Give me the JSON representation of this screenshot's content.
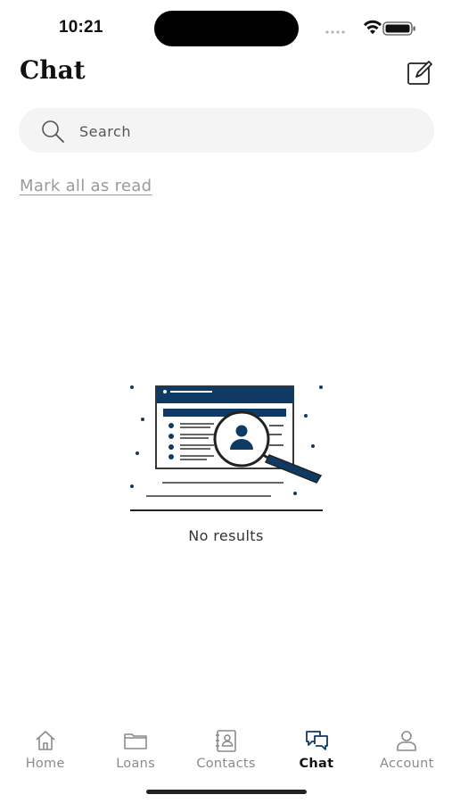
{
  "status_bar": {
    "time": "10:21",
    "icons": [
      "signal-icon",
      "wifi-icon",
      "battery-icon"
    ]
  },
  "header": {
    "title": "Chat",
    "compose_icon": "compose-icon"
  },
  "search": {
    "placeholder": "Search",
    "value": ""
  },
  "actions": {
    "mark_all_read": "Mark all as read"
  },
  "empty_state": {
    "message": "No results",
    "illustration": "search-person-illustration"
  },
  "tabs": [
    {
      "label": "Home",
      "icon": "home-icon",
      "active": false
    },
    {
      "label": "Loans",
      "icon": "folder-icon",
      "active": false
    },
    {
      "label": "Contacts",
      "icon": "contacts-book-icon",
      "active": false
    },
    {
      "label": "Chat",
      "icon": "chat-bubbles-icon",
      "active": true
    },
    {
      "label": "Account",
      "icon": "person-icon",
      "active": false
    }
  ],
  "colors": {
    "accent": "#0f3a63",
    "text": "#111111",
    "muted": "#8a8a8a",
    "search_bg": "#f4f4f4"
  }
}
